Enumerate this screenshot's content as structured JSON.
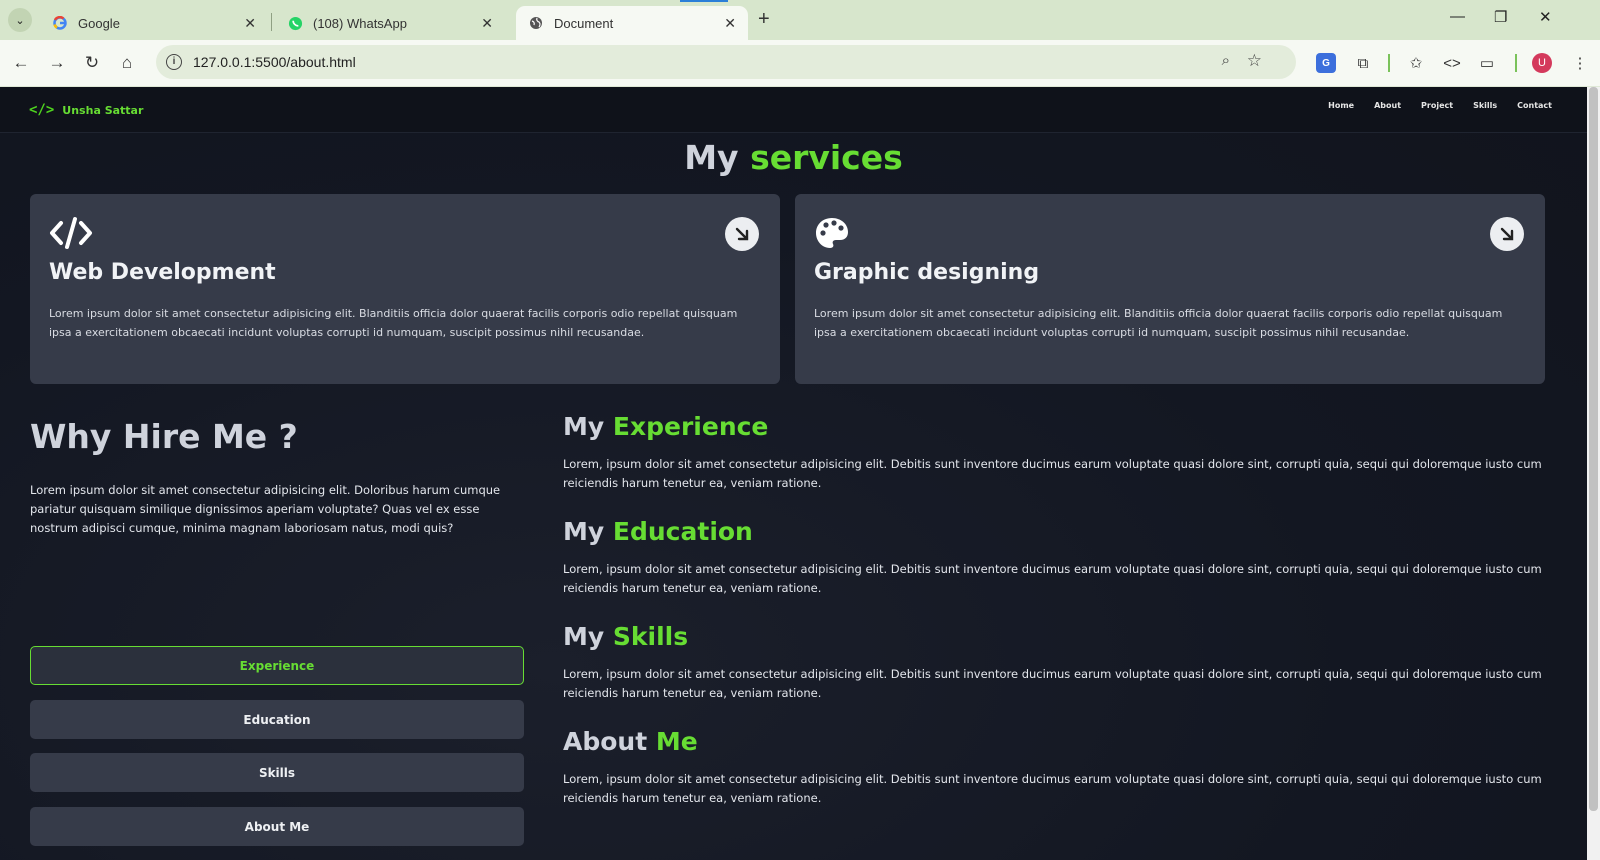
{
  "browser": {
    "tabs": [
      {
        "title": "Google",
        "favicon": "google-icon"
      },
      {
        "title": "(108) WhatsApp",
        "favicon": "whatsapp-icon"
      },
      {
        "title": "Document",
        "favicon": "globe-icon",
        "active": true
      }
    ],
    "url": "127.0.0.1:5500/about.html",
    "profile_initial": "U"
  },
  "site": {
    "brand": "Unsha Sattar",
    "nav": [
      "Home",
      "About",
      "Project",
      "Skills",
      "Contact"
    ]
  },
  "services": {
    "title_plain": "My",
    "title_highlight": "services",
    "cards": [
      {
        "icon": "code-icon",
        "title": "Web Development",
        "text": "Lorem ipsum dolor sit amet consectetur adipisicing elit. Blanditiis officia dolor quaerat facilis corporis odio repellat quisquam ipsa a exercitationem obcaecati incidunt voluptas corrupti id numquam, suscipit possimus nihil recusandae."
      },
      {
        "icon": "palette-icon",
        "title": "Graphic designing",
        "text": "Lorem ipsum dolor sit amet consectetur adipisicing elit. Blanditiis officia dolor quaerat facilis corporis odio repellat quisquam ipsa a exercitationem obcaecati incidunt voluptas corrupti id numquam, suscipit possimus nihil recusandae."
      }
    ]
  },
  "why": {
    "title": "Why Hire Me ?",
    "text": "Lorem ipsum dolor sit amet consectetur adipisicing elit. Doloribus harum cumque pariatur quisquam similique dignissimos aperiam voluptate? Quas vel ex esse nostrum adipisci cumque, minima magnam laboriosam natus, modi quis?",
    "buttons": [
      "Experience",
      "Education",
      "Skills",
      "About Me"
    ],
    "active_button": "Experience"
  },
  "sections": [
    {
      "plain": "My",
      "highlight": "Experience",
      "text": "Lorem, ipsum dolor sit amet consectetur adipisicing elit. Debitis sunt inventore ducimus earum voluptate quasi dolore sint, corrupti quia, sequi qui doloremque iusto cum reiciendis harum tenetur ea, veniam ratione."
    },
    {
      "plain": "My",
      "highlight": "Education",
      "text": "Lorem, ipsum dolor sit amet consectetur adipisicing elit. Debitis sunt inventore ducimus earum voluptate quasi dolore sint, corrupti quia, sequi qui doloremque iusto cum reiciendis harum tenetur ea, veniam ratione."
    },
    {
      "plain": "My",
      "highlight": "Skills",
      "text": "Lorem, ipsum dolor sit amet consectetur adipisicing elit. Debitis sunt inventore ducimus earum voluptate quasi dolore sint, corrupti quia, sequi qui doloremque iusto cum reiciendis harum tenetur ea, veniam ratione."
    },
    {
      "plain": "About",
      "highlight": "Me",
      "text": "Lorem, ipsum dolor sit amet consectetur adipisicing elit. Debitis sunt inventore ducimus earum voluptate quasi dolore sint, corrupti quia, sequi qui doloremque iusto cum reiciendis harum tenetur ea, veniam ratione."
    }
  ],
  "colors": {
    "accent": "#67dd33",
    "page_bg": "#131722",
    "card_bg": "#363b49",
    "browser_chrome": "#d7e6cc"
  }
}
